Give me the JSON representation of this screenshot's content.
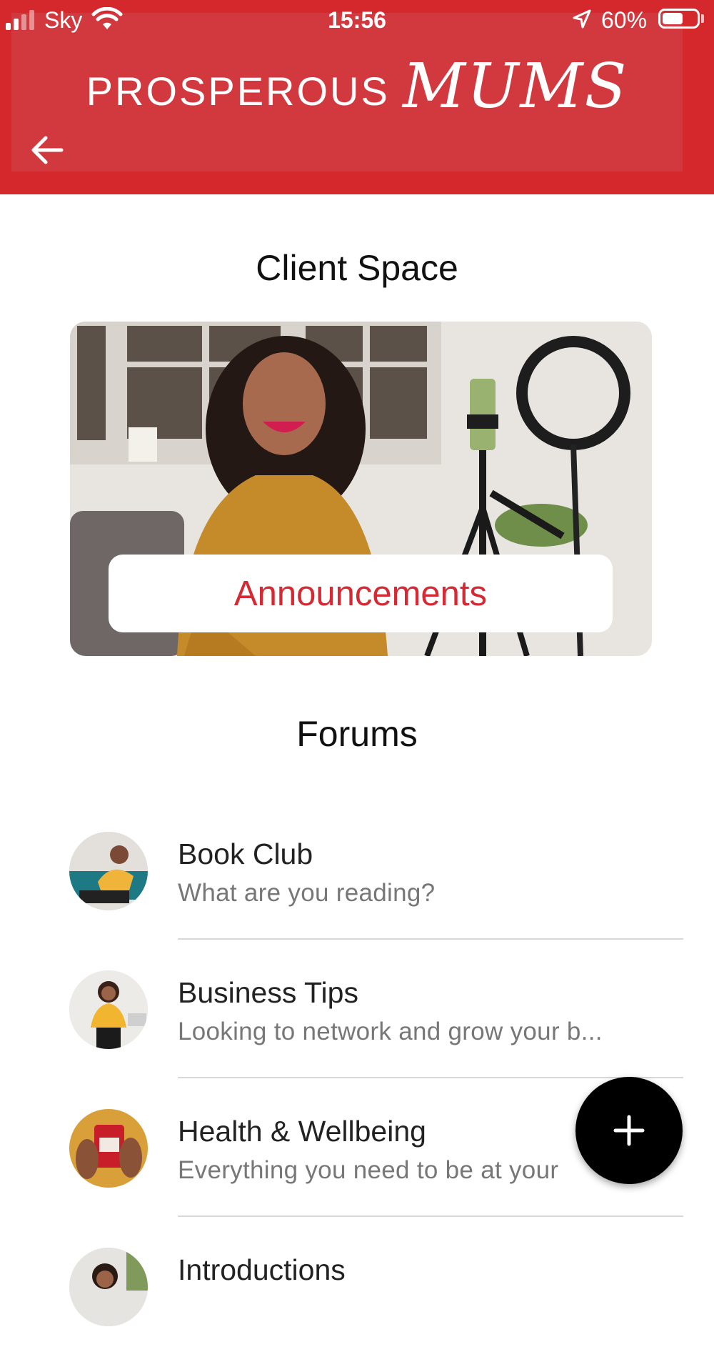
{
  "status_bar": {
    "carrier": "Sky",
    "time": "15:56",
    "battery_percent": "60%",
    "battery_level": 0.6,
    "signal_bars_filled": 2,
    "signal_bars_total": 4
  },
  "header": {
    "brand_main": "PROSPEROUS",
    "brand_script": "MUMS",
    "back_icon": "arrow-left-icon",
    "background_color": "#d4282d"
  },
  "main": {
    "client_space_title": "Client Space",
    "announcements_label": "Announcements",
    "forums_title": "Forums",
    "accent_color": "#d52a33"
  },
  "forums": [
    {
      "name": "Book Club",
      "description": "What are you reading?"
    },
    {
      "name": "Business Tips",
      "description": "Looking to network and grow your b..."
    },
    {
      "name": "Health & Wellbeing",
      "description": "Everything you need to be at your"
    },
    {
      "name": "Introductions",
      "description": ""
    }
  ],
  "fab": {
    "icon": "plus-icon"
  }
}
